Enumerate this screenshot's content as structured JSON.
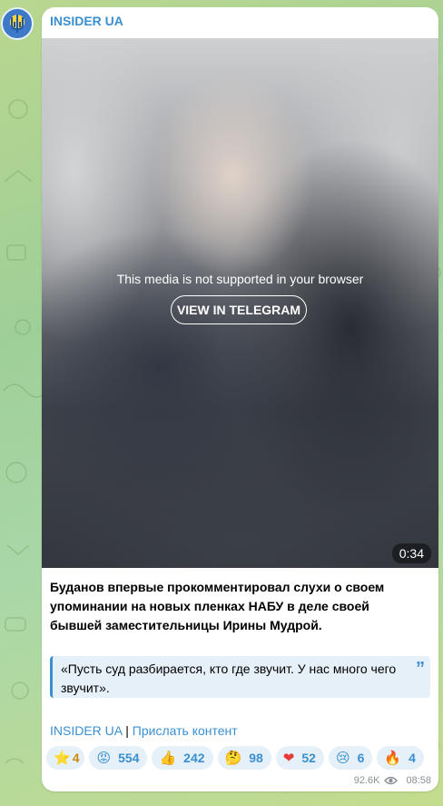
{
  "channel": {
    "name": "INSIDER UA"
  },
  "media": {
    "message": "This media is not supported in your browser",
    "button_label": "VIEW IN TELEGRAM",
    "duration": "0:34"
  },
  "post": {
    "text": "Буданов впервые прокомментировал слухи о своем упоминании на новых пленках НАБУ в деле своей бывшей заместительницы Ирины Мудрой.",
    "quote": "«Пусть суд разбирается, кто где звучит. У нас много чего звучит».",
    "link1": "INSIDER UA",
    "separator": "|",
    "link2": "Прислать контент"
  },
  "reactions": [
    {
      "icon": "star-icon",
      "emoji": "⭐",
      "count": "4"
    },
    {
      "icon": "angry-face-icon",
      "emoji": "😡",
      "count": "554"
    },
    {
      "icon": "thumbs-up-icon",
      "emoji": "👍",
      "count": "242"
    },
    {
      "icon": "thinking-face-icon",
      "emoji": "🤔",
      "count": "98"
    },
    {
      "icon": "heart-icon",
      "emoji": "❤",
      "count": "52"
    },
    {
      "icon": "crying-face-icon",
      "emoji": "😢",
      "count": "6"
    },
    {
      "icon": "fire-icon",
      "emoji": "🔥",
      "count": "4"
    }
  ],
  "meta": {
    "views": "92.6K",
    "time": "08:58"
  }
}
